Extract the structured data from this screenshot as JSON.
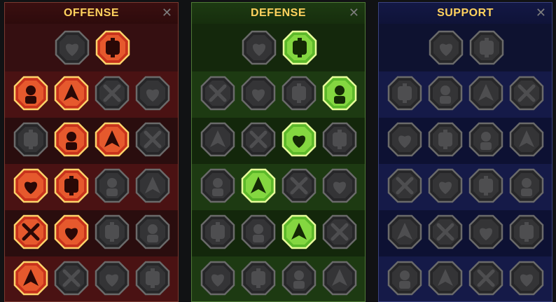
{
  "panels": {
    "offense": {
      "title": "OFFENSE",
      "close_label": "✕",
      "accent": "#ffd25e",
      "top_row": [
        {
          "name": "crossed-swords-icon",
          "active": false
        },
        {
          "name": "flaming-blade-icon",
          "active": true
        }
      ],
      "grid": [
        [
          {
            "name": "horned-demon-icon",
            "active": true
          },
          {
            "name": "slashing-claws-icon",
            "active": true
          },
          {
            "name": "shield-arrow-icon",
            "active": false
          },
          {
            "name": "broken-heart-icon",
            "active": false
          }
        ],
        [
          {
            "name": "flexed-arm-icon",
            "active": false
          },
          {
            "name": "fanged-jaws-icon",
            "active": true
          },
          {
            "name": "skull-cape-icon",
            "active": true
          },
          {
            "name": "reaching-hand-icon",
            "active": false
          }
        ],
        [
          {
            "name": "dagger-drop-icon",
            "active": true
          },
          {
            "name": "fist-strike-icon",
            "active": true
          },
          {
            "name": "axe-icon",
            "active": false
          },
          {
            "name": "chain-lightning-icon",
            "active": false
          }
        ],
        [
          {
            "name": "arrow-burst-icon",
            "active": true
          },
          {
            "name": "twin-skulls-icon",
            "active": true
          },
          {
            "name": "cleaver-icon",
            "active": false
          },
          {
            "name": "warrior-icon",
            "active": false
          }
        ],
        [
          {
            "name": "sparkling-sword-icon",
            "active": true
          },
          {
            "name": "knight-helmet-icon",
            "active": false
          },
          {
            "name": "beast-icon",
            "active": false
          },
          {
            "name": "skull-warrior-icon",
            "active": false
          }
        ]
      ]
    },
    "defense": {
      "title": "DEFENSE",
      "close_label": "✕",
      "accent": "#ffd25e",
      "top_row": [
        {
          "name": "brick-wall-icon",
          "active": false
        },
        {
          "name": "raised-fist-icon",
          "active": true
        }
      ],
      "grid": [
        [
          {
            "name": "armor-icon",
            "active": false
          },
          {
            "name": "heart-shield-icon",
            "active": false
          },
          {
            "name": "muscle-man-icon",
            "active": false
          },
          {
            "name": "broken-blade-icon",
            "active": true
          }
        ],
        [
          {
            "name": "archer-icon",
            "active": false
          },
          {
            "name": "knight-shield-icon",
            "active": false
          },
          {
            "name": "skull-heart-icon",
            "active": true
          },
          {
            "name": "halo-figure-icon",
            "active": false
          }
        ],
        [
          {
            "name": "crowd-icon",
            "active": false
          },
          {
            "name": "hourglass-icon",
            "active": true
          },
          {
            "name": "palm-hand-icon",
            "active": false
          },
          {
            "name": "bull-head-icon",
            "active": false
          }
        ],
        [
          {
            "name": "sprinting-figure-icon",
            "active": false
          },
          {
            "name": "triple-flame-icon",
            "active": false
          },
          {
            "name": "radiant-skull-icon",
            "active": true
          },
          {
            "name": "spiral-icon",
            "active": false
          }
        ],
        [
          {
            "name": "shield-beast-icon",
            "active": false
          },
          {
            "name": "cracked-shield-icon",
            "active": false
          },
          {
            "name": "bearded-skull-icon",
            "active": false
          },
          {
            "name": "strongman-icon",
            "active": false
          }
        ]
      ]
    },
    "support": {
      "title": "SUPPORT",
      "close_label": "✕",
      "accent": "#ffd25e",
      "top_row": [
        {
          "name": "sparkling-heart-icon",
          "active": false
        },
        {
          "name": "knot-icon",
          "active": false
        }
      ],
      "grid": [
        [
          {
            "name": "praying-hands-icon",
            "active": false
          },
          {
            "name": "ward-shield-icon",
            "active": false
          },
          {
            "name": "flaming-skull-icon",
            "active": false
          },
          {
            "name": "speed-boot-icon",
            "active": false
          }
        ],
        [
          {
            "name": "blessed-figure-icon",
            "active": false
          },
          {
            "name": "lightning-shield-icon",
            "active": false
          },
          {
            "name": "crack-icon",
            "active": false
          },
          {
            "name": "shadow-figure-icon",
            "active": false
          }
        ],
        [
          {
            "name": "chained-heart-icon",
            "active": false
          },
          {
            "name": "meteor-icon",
            "active": false
          },
          {
            "name": "open-book-icon",
            "active": false
          },
          {
            "name": "angry-face-icon",
            "active": false
          }
        ],
        [
          {
            "name": "compass-star-icon",
            "active": false
          },
          {
            "name": "fast-boot-icon",
            "active": false
          },
          {
            "name": "watching-eye-icon",
            "active": false
          },
          {
            "name": "kicking-figure-icon",
            "active": false
          }
        ],
        [
          {
            "name": "poison-flask-icon",
            "active": false
          },
          {
            "name": "skull-icon",
            "active": false
          },
          {
            "name": "fist-skull-icon",
            "active": false
          },
          {
            "name": "eagle-head-icon",
            "active": false
          }
        ]
      ]
    }
  },
  "colors": {
    "offense_active": "#e8482a",
    "defense_active": "#7fd63a",
    "inactive": "#2a2a2c"
  }
}
